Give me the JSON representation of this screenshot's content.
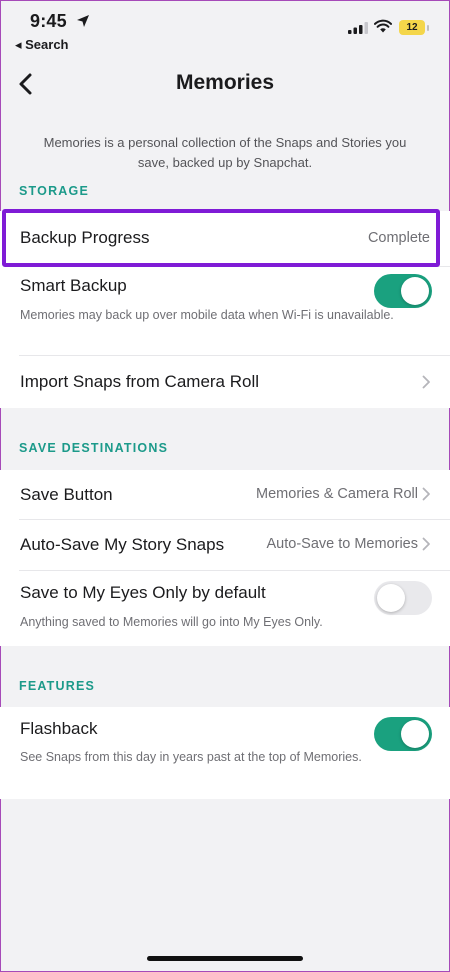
{
  "status_bar": {
    "time": "9:45",
    "back_app": "◂ Search",
    "battery": "12"
  },
  "nav": {
    "title": "Memories"
  },
  "description": "Memories is a personal collection of the Snaps and Stories you save, backed up by Snapchat.",
  "storage": {
    "header": "STORAGE",
    "backup_progress": {
      "label": "Backup Progress",
      "value": "Complete"
    },
    "smart_backup": {
      "label": "Smart Backup",
      "toggle_on": true,
      "description": "Memories may back up over mobile data when Wi-Fi is unavailable."
    },
    "import_snaps": {
      "label": "Import Snaps from Camera Roll"
    }
  },
  "save_destinations": {
    "header": "SAVE DESTINATIONS",
    "save_button": {
      "label": "Save Button",
      "value": "Memories & Camera Roll"
    },
    "auto_save": {
      "label": "Auto-Save My Story Snaps",
      "value": "Auto-Save to Memories"
    },
    "my_eyes_only": {
      "label": "Save to My Eyes Only by default",
      "toggle_on": false,
      "description": "Anything saved to Memories will go into My Eyes Only."
    }
  },
  "features": {
    "header": "FEATURES",
    "flashback": {
      "label": "Flashback",
      "toggle_on": true,
      "description": "See Snaps from this day in years past at the top of Memories."
    }
  },
  "colors": {
    "accent_teal": "#1c9a8a",
    "toggle_on": "#1aa17f",
    "highlight": "#7f1bd6",
    "battery": "#f4d64a"
  }
}
